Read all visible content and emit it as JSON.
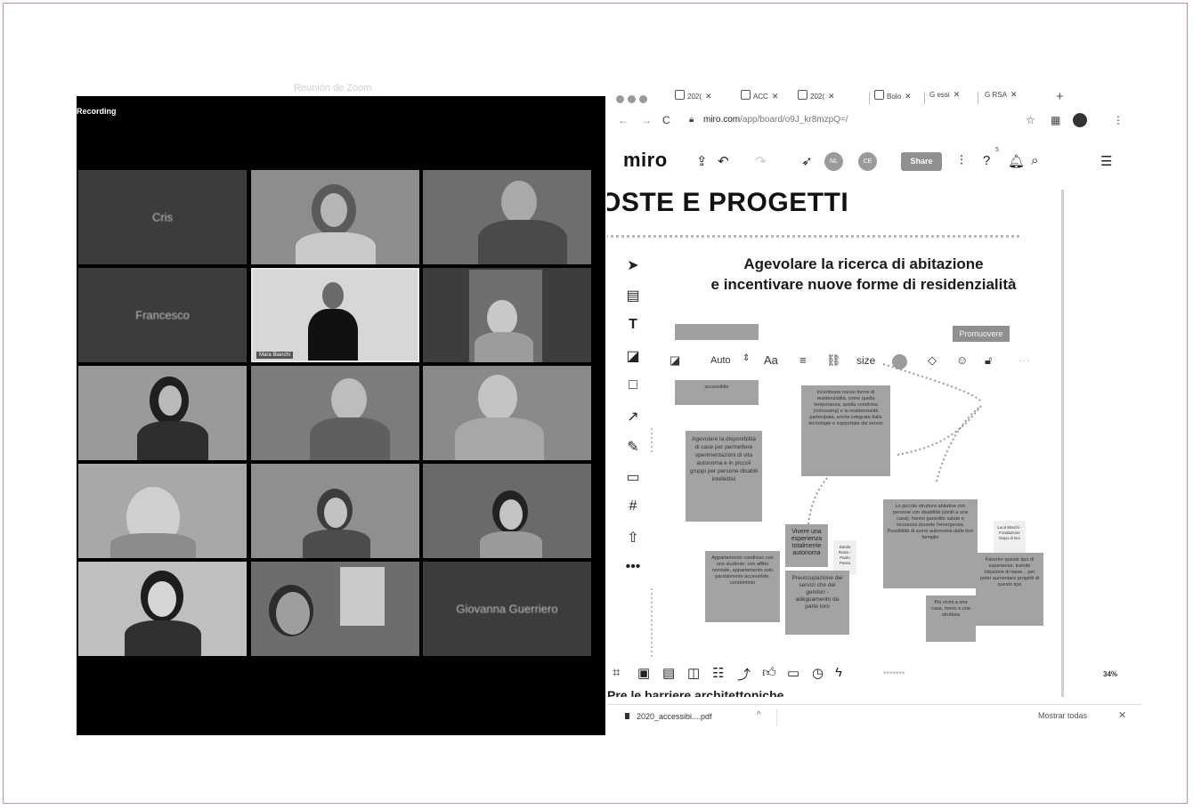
{
  "zoom": {
    "window_title": "Reunión de Zoom",
    "recording_label": "Recording",
    "participants": [
      "Cris",
      "Francesco",
      "Giovanna Guerriero"
    ],
    "presenter_tag": "Mara Bianchi"
  },
  "browser": {
    "tabs": [
      "202(",
      "ACC",
      "202(",
      "Bolo",
      "essi",
      "RSA"
    ],
    "url_host": "miro.com",
    "url_path": "/app/board/o9J_kr8mzpQ=/",
    "download_file": "2020_accessibi....pdf",
    "show_all": "Mostrar todas"
  },
  "miro": {
    "logo": "miro",
    "avatars": [
      "NL",
      "CE"
    ],
    "share_label": "Share",
    "notif_count": "5",
    "frame_title": "OSTE E PROGETTI",
    "subtitle_line1": "Agevolare la ricerca di abitazione",
    "subtitle_line2": "e incentivare nuove forme di residenzialità",
    "context_toolbar": {
      "font_mode": "Auto",
      "font_icon": "Aa",
      "size_label": "size"
    },
    "promuovere": "Promuovere",
    "stickies": {
      "s_accessibile": "accessibile",
      "s_incentivare": "Incentivare nuove forme di residenzialità, come quella temporanea, quella condivisa (cohousing) e la residenzialità partecipata, anche integrata dalle tecnologie e supportata dai servizi",
      "s_agevolare": "Agevolare la disponibilità di case per permettere sperimentazioni di vita autonoma e in piccoli gruppi per persone disabili intellettivi",
      "s_vivere": "Vivere una esperienza totalmente autonoma",
      "s_danilo": "Danilo Rosio - Paolo Passo",
      "s_piccole": "Le piccole strutture abitative con persone con disabilità (simili a una casa), hanno garantito salute e sicurezza durante l'emergenza. Possibilità di avere autonomia dalle loro famiglie",
      "s_luca": "Luca Marchi - Fondazione Dopo di Noi",
      "s_appartamento": "Appartamento condiviso con uno studente, con affitto normale, appartamento solo parzialmente accessibile, condominio",
      "s_preoccupazione": "Preoccupazione dei servizi che dei genitori - adeguamento da parte loro",
      "s_favorire": "Favorire queste tipo di esperienze, tramite riduzione di tasse... per poter aumentare progetti di questo tipo",
      "s_piu_vicini": "Più vicini a una casa, meno a una struttura"
    },
    "partial_heading": "Pre le barriere architettoniche",
    "zoom_level": "34%"
  },
  "colors": {
    "frame_border": "#d98a8a",
    "zoom_bg": "#000000",
    "sticky_gray": "#a3a3a3"
  }
}
